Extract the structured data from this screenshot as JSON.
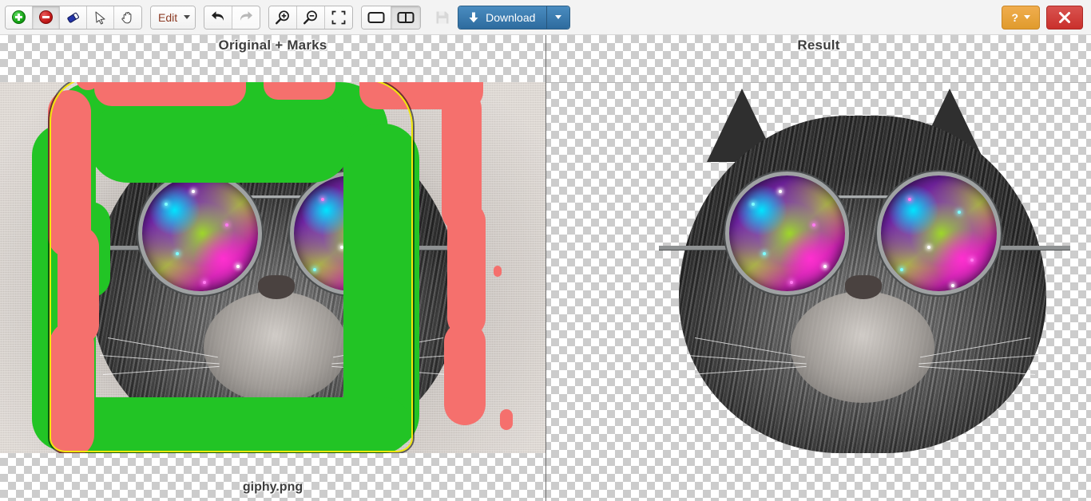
{
  "app": {
    "title": "Background removal editor"
  },
  "toolbar": {
    "tools": [
      {
        "name": "add-mark-tool",
        "icon": "plus-circle-green-icon",
        "label": "Add (keep) brush",
        "state": "normal"
      },
      {
        "name": "remove-mark-tool",
        "icon": "minus-circle-red-icon",
        "label": "Remove brush",
        "state": "active"
      },
      {
        "name": "eraser-tool",
        "icon": "eraser-icon",
        "label": "Eraser",
        "state": "normal"
      },
      {
        "name": "pointer-tool",
        "icon": "cursor-arrow-icon",
        "label": "Select",
        "state": "normal"
      },
      {
        "name": "pan-tool",
        "icon": "hand-icon",
        "label": "Pan",
        "state": "normal"
      }
    ],
    "edit_menu": {
      "label": "Edit",
      "icon": "chevron-down-icon"
    },
    "history": [
      {
        "name": "undo-button",
        "icon": "undo-arrow-icon",
        "label": "Undo",
        "state": "normal"
      },
      {
        "name": "redo-button",
        "icon": "redo-arrow-icon",
        "label": "Redo",
        "state": "disabled"
      }
    ],
    "zoom_controls": [
      {
        "name": "zoom-in-button",
        "icon": "magnifier-plus-icon",
        "label": "Zoom in"
      },
      {
        "name": "zoom-out-button",
        "icon": "magnifier-minus-icon",
        "label": "Zoom out"
      },
      {
        "name": "fit-screen-button",
        "icon": "expand-frame-icon",
        "label": "Fit to screen"
      }
    ],
    "view_modes": [
      {
        "name": "single-view-button",
        "icon": "single-pane-icon",
        "label": "Single view",
        "state": "normal"
      },
      {
        "name": "split-view-button",
        "icon": "split-pane-icon",
        "label": "Split view",
        "state": "active"
      }
    ],
    "save": {
      "label": "Save",
      "icon": "floppy-disk-icon",
      "state": "disabled"
    },
    "download": {
      "label": "Download",
      "icon": "download-arrow-icon",
      "dropdown_icon": "chevron-down-icon"
    },
    "help": {
      "label": "?",
      "icon": "chevron-down-icon"
    },
    "close": {
      "label": "✕",
      "icon": "close-x-icon"
    }
  },
  "panels": {
    "left": {
      "title": "Original + Marks",
      "caption": "giphy.png"
    },
    "right": {
      "title": "Result",
      "caption": ""
    }
  },
  "colors": {
    "keep_mark": "#22c425",
    "remove_mark": "#f5706d",
    "selection_outline": "#f2e70b",
    "download_button": "#2e6b9e",
    "help_button": "#e09b2d",
    "close_button": "#c9302c",
    "checkerboard_light": "#ffffff",
    "checkerboard_dark": "#cccccc"
  }
}
